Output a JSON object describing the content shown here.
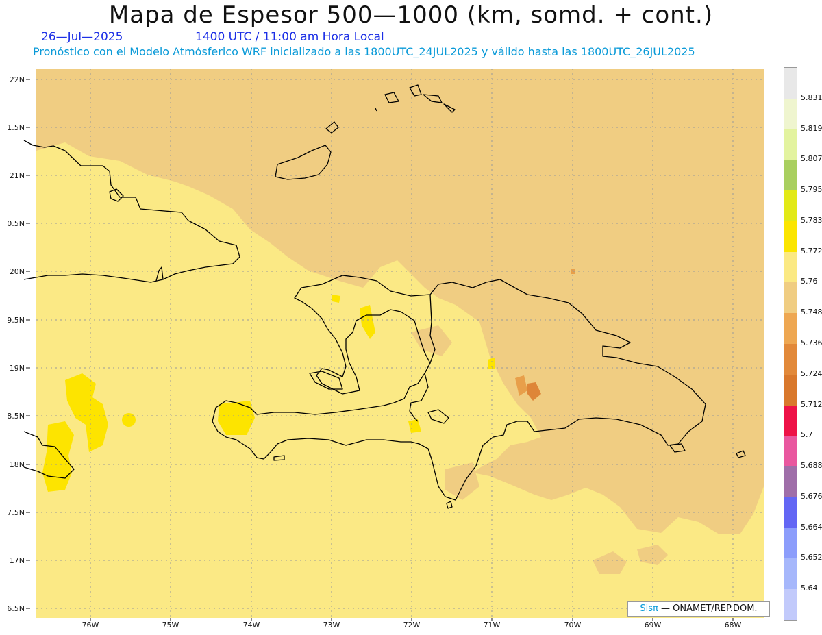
{
  "header": {
    "title": "Mapa de Espesor 500—1000 (km, somd. + cont.)",
    "date": "26—Jul—2025",
    "time": "1400 UTC / 11:00 am Hora Local",
    "forecast_note": "Pronóstico con el Modelo Atmósferico WRF inicializado a las 1800UTC_24JUL2025 y válido hasta las  1800UTC_26JUL2025"
  },
  "axes": {
    "lat_labels": [
      "22N",
      "1.5N",
      "21N",
      "0.5N",
      "20N",
      "9.5N",
      "19N",
      "8.5N",
      "18N",
      "7.5N",
      "17N",
      "6.5N"
    ],
    "lon_labels": [
      "76W",
      "75W",
      "74W",
      "73W",
      "72W",
      "71W",
      "70W",
      "69W",
      "68W"
    ]
  },
  "colors": {
    "sea_band": "#f0cd82",
    "land_band": "#fbe985",
    "highlight": "#fde400",
    "warm1": "#e89f4a",
    "warm2": "#de8638",
    "coast": "#000000"
  },
  "colorbar": {
    "labels": [
      "5.831",
      "5.819",
      "5.807",
      "5.795",
      "5.783",
      "5.772",
      "5.76",
      "5.748",
      "5.736",
      "5.724",
      "5.712",
      "5.7",
      "5.688",
      "5.676",
      "5.664",
      "5.652",
      "5.64"
    ],
    "colors": [
      "#e8e8e8",
      "#eff5cf",
      "#e3f39f",
      "#a9cf5f",
      "#e2e916",
      "#fbe500",
      "#fbe983",
      "#f0cd82",
      "#eea752",
      "#e2893a",
      "#d9782c",
      "#ee1247",
      "#e9579f",
      "#9f6ea9",
      "#6366f4",
      "#8c9dfb",
      "#a6b7fb",
      "#c2cafb"
    ]
  },
  "credit": {
    "sis": "Sisπ",
    "rest": "— ONAMET/REP.DOM."
  }
}
